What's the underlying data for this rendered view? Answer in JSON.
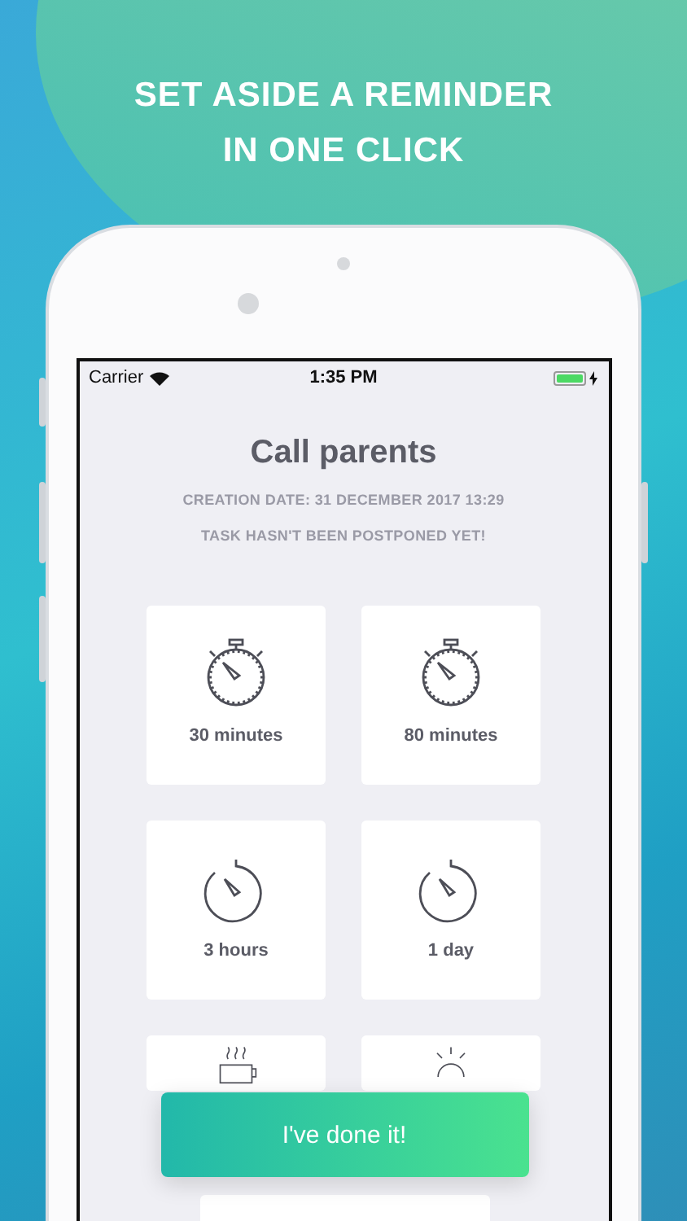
{
  "headline": [
    "SET ASIDE A REMINDER",
    "IN ONE CLICK"
  ],
  "status_bar": {
    "carrier": "Carrier",
    "time": "1:35 PM",
    "charging": true
  },
  "task": {
    "title": "Call parents",
    "creation_date": "CREATION DATE: 31 DECEMBER 2017 13:29",
    "postpone_status": "TASK HASN'T BEEN POSTPONED YET!"
  },
  "options": [
    {
      "kind": "stopwatch",
      "label": "30 minutes"
    },
    {
      "kind": "stopwatch",
      "label": "80 minutes"
    },
    {
      "kind": "timer",
      "label": "3 hours"
    },
    {
      "kind": "timer",
      "label": "1 day"
    },
    {
      "kind": "cup"
    },
    {
      "kind": "sunrise"
    }
  ],
  "done_button": "I've done it!"
}
